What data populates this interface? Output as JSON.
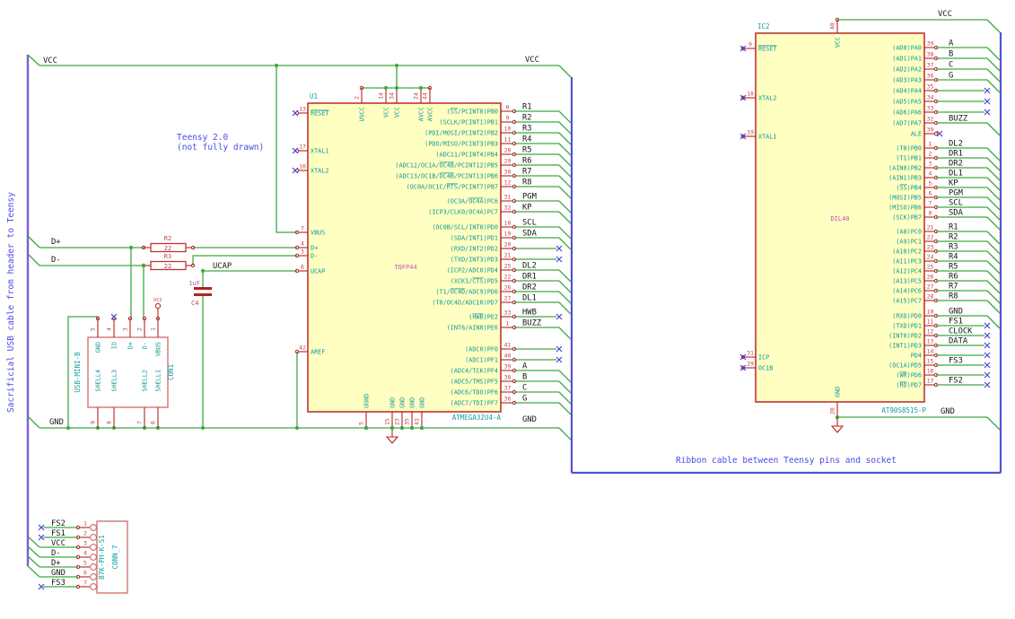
{
  "notes": {
    "teensy_line1": "Teensy 2.0",
    "teensy_line2": "(not fully drawn)",
    "sacrificial": "Sacrificial USB cable from header to Teensy",
    "ribbon": "Ribbon cable between Teensy pins and socket"
  },
  "colors": {
    "wire": "#3fa93f",
    "bus_left": "#7a5fd6",
    "bus_ribbon": "#5252cf",
    "ic_fill": "#ffffc2",
    "ic_border": "#c03434",
    "pin": "#b52222",
    "pin_number": "#c04545",
    "pin_name": "#0f9898",
    "reference": "#12a0a0",
    "value": "#c14fc1",
    "net_label": "#161616",
    "note": "#4a4ae8",
    "no_connect": "#4646d8",
    "connector_border": "#d06a6a",
    "junction": "#3fa93f"
  },
  "u1": {
    "ref": "U1",
    "value": "ATMEGA32U4-A",
    "package": "TQFP44",
    "top_pins": [
      {
        "num": "2",
        "name": "UVCC"
      },
      {
        "num": "14",
        "name": "VCC"
      },
      {
        "num": "34",
        "name": "VCC"
      },
      {
        "num": "24",
        "name": "AVCC"
      },
      {
        "num": "44",
        "name": "AVCC"
      }
    ],
    "bottom_pins": [
      {
        "num": "5",
        "name": "UGND"
      },
      {
        "num": "15",
        "name": "GND"
      },
      {
        "num": "23",
        "name": "GND"
      },
      {
        "num": "35",
        "name": "GND"
      },
      {
        "num": "43",
        "name": "GND"
      }
    ],
    "left_pins": [
      {
        "num": "13",
        "name": "~RESET~",
        "nc": true
      },
      {
        "num": "17",
        "name": "XTAL1",
        "nc": true
      },
      {
        "num": "16",
        "name": "XTAL2",
        "nc": true
      },
      {
        "num": "7",
        "name": "VBUS"
      },
      {
        "num": "4",
        "name": "D+"
      },
      {
        "num": "3",
        "name": "D-"
      },
      {
        "num": "6",
        "name": "UCAP"
      },
      {
        "num": "42",
        "name": "AREF"
      }
    ],
    "right_groups": [
      [
        {
          "num": "8",
          "name": "(~SS~/PCINT0)PB0",
          "net": "R1"
        },
        {
          "num": "9",
          "name": "(SCLK/PCINT1)PB1",
          "net": "R2"
        },
        {
          "num": "10",
          "name": "(PDI/MOSI/PCINT2)PB2",
          "net": "R3"
        },
        {
          "num": "11",
          "name": "(PDO/MISO/PCINT3)PB3",
          "net": "R4"
        },
        {
          "num": "28",
          "name": "(ADC11/PCINT4)PB4",
          "net": "R5"
        },
        {
          "num": "29",
          "name": "(ADC12/OC1A/~OC4B~/PCINT12)PB5",
          "net": "R6"
        },
        {
          "num": "30",
          "name": "(ADC13/OC1B/~OC4B~/PCINT13)PB6",
          "net": "R7"
        },
        {
          "num": "12",
          "name": "(OC0A/OC1C/~RTS~/PCINT7)PB7",
          "net": "R8"
        }
      ],
      [
        {
          "num": "31",
          "name": "(OC3A/~OC4A~)PC6",
          "net": "PGM"
        },
        {
          "num": "32",
          "name": "(ICP3/CLK0/OC4A)PC7",
          "net": "KP"
        }
      ],
      [
        {
          "num": "18",
          "name": "(OC0B/SCL/INT0)PD0",
          "net": "SCL"
        },
        {
          "num": "19",
          "name": "(SDA/INT1)PD1",
          "net": "SDA"
        },
        {
          "num": "20",
          "name": "(RXD/INT2)PD2",
          "nc": true
        },
        {
          "num": "21",
          "name": "(TXD/INT3)PD3",
          "nc": true
        },
        {
          "num": "25",
          "name": "(ICP2/ADC8)PD4",
          "net": "DL2"
        },
        {
          "num": "22",
          "name": "(XCK1/~CTS~)PD5",
          "net": "DR1"
        },
        {
          "num": "26",
          "name": "(T1/~OC4D~/ADC9)PD6",
          "net": "DR2"
        },
        {
          "num": "27",
          "name": "(T0/OC4D/ADC10)PD7",
          "net": "DL1"
        }
      ],
      [
        {
          "num": "33",
          "name": "(~HWB~)PE2",
          "net": "HWB",
          "nc": true
        },
        {
          "num": "1",
          "name": "(INT6/AIN0)PE6",
          "net": "BUZZ"
        }
      ],
      [
        {
          "num": "41",
          "name": "(ADC0)PF0",
          "nc": true
        },
        {
          "num": "40",
          "name": "(ADC1)PF1",
          "nc": true
        },
        {
          "num": "39",
          "name": "(ADC4/TCK)PF4",
          "net": "A"
        },
        {
          "num": "38",
          "name": "(ADC5/TMS)PF5",
          "net": "B"
        },
        {
          "num": "37",
          "name": "(ADC6/TDO)PF6",
          "net": "C"
        },
        {
          "num": "36",
          "name": "(ADC7/TDI)PF7",
          "net": "G"
        }
      ]
    ]
  },
  "ic2": {
    "ref": "IC2",
    "value": "AT90S8515-P",
    "package": "DIL40",
    "top_pin": {
      "num": "40",
      "name": "VCC"
    },
    "bottom_pin": {
      "num": "20",
      "name": "GND"
    },
    "left_pins": [
      {
        "num": "9",
        "name": "~RESET~",
        "nc": true
      },
      {
        "num": "18",
        "name": "XTAL2",
        "nc": true
      },
      {
        "num": "19",
        "name": "XTAL1",
        "nc": true
      },
      {
        "num": "31",
        "name": "ICP",
        "nc": true
      },
      {
        "num": "29",
        "name": "OC1B",
        "nc": true
      }
    ],
    "right_groups": [
      [
        {
          "num": "39",
          "name": "(AD0)PA0",
          "net": "A"
        },
        {
          "num": "38",
          "name": "(AD1)PA1",
          "net": "B"
        },
        {
          "num": "37",
          "name": "(AD2)PA2",
          "net": "C"
        },
        {
          "num": "36",
          "name": "(AD3)PA3",
          "net": "G"
        },
        {
          "num": "35",
          "name": "(AD4)PA4",
          "nc": true
        },
        {
          "num": "34",
          "name": "(AD5)PA5",
          "nc": true
        },
        {
          "num": "33",
          "name": "(AD6)PA6",
          "nc": true
        },
        {
          "num": "32",
          "name": "(AD7)PA7",
          "net": "BUZZ"
        }
      ],
      [
        {
          "num": "30",
          "name": "ALE",
          "conn": "ncstub"
        }
      ],
      [
        {
          "num": "1",
          "name": "(T0)PB0",
          "net": "DL2"
        },
        {
          "num": "2",
          "name": "(T1)PB1",
          "net": "DR1"
        },
        {
          "num": "3",
          "name": "(AIN0)PB2",
          "net": "DR2"
        },
        {
          "num": "4",
          "name": "(AIN1)PB3",
          "net": "DL1"
        },
        {
          "num": "5",
          "name": "(~SS~)PB4",
          "net": "KP"
        },
        {
          "num": "6",
          "name": "(MOSI)PB5",
          "net": "PGM"
        },
        {
          "num": "7",
          "name": "(MISO)PB6",
          "net": "SCL"
        },
        {
          "num": "8",
          "name": "(SCK)PB7",
          "net": "SDA"
        }
      ],
      [
        {
          "num": "21",
          "name": "(A8)PC0",
          "net": "R1"
        },
        {
          "num": "22",
          "name": "(A9)PC1",
          "net": "R2"
        },
        {
          "num": "23",
          "name": "(A10)PC2",
          "net": "R3"
        },
        {
          "num": "24",
          "name": "(A11)PC3",
          "net": "R4"
        },
        {
          "num": "25",
          "name": "(A12)PC4",
          "net": "R5"
        },
        {
          "num": "26",
          "name": "(A13)PC5",
          "net": "R6"
        },
        {
          "num": "27",
          "name": "(A14)PC6",
          "net": "R7"
        },
        {
          "num": "28",
          "name": "(A15)PC7",
          "net": "R8"
        }
      ],
      [
        {
          "num": "10",
          "name": "(RXD)PD0",
          "net": "GND"
        },
        {
          "num": "11",
          "name": "(TXD)PD1",
          "net": "FS1",
          "nc": true
        },
        {
          "num": "12",
          "name": "(INT0)PD2",
          "net": "CLOCK",
          "nc": true
        },
        {
          "num": "13",
          "name": "(INT1)PD3",
          "net": "DATA",
          "nc": true
        },
        {
          "num": "14",
          "name": "PD4",
          "nc": true
        },
        {
          "num": "15",
          "name": "(OC1A)PD5",
          "net": "FS3",
          "nc": true
        },
        {
          "num": "16",
          "name": "(~WR~)PD6",
          "nc": true
        },
        {
          "num": "17",
          "name": "(~RD~)PD7",
          "net": "FS2",
          "nc": true
        }
      ]
    ]
  },
  "con1": {
    "ref": "CON1",
    "part": "USB-MINI-B",
    "top_pins": [
      {
        "num": "5",
        "name": "GND"
      },
      {
        "num": "4",
        "name": "ID",
        "nc": true
      },
      {
        "num": "3",
        "name": "D+"
      },
      {
        "num": "2",
        "name": "D-"
      },
      {
        "num": "1",
        "name": "VBUS"
      }
    ],
    "bottom_pins": [
      {
        "num": "9",
        "name": "SHELL4"
      },
      {
        "num": "8",
        "name": "SHELL3"
      },
      {
        "num": "7",
        "name": "SHELL2"
      },
      {
        "num": "6",
        "name": "SHELL1"
      }
    ],
    "vcc_symbol": "VCC"
  },
  "conn7": {
    "ref": "CONN_7",
    "part": "B7K-PH-K-S1",
    "pins": [
      {
        "num": "1",
        "net": "FS2",
        "nc": true
      },
      {
        "num": "2",
        "net": "FS1",
        "nc": true
      },
      {
        "num": "3",
        "net": "VCC"
      },
      {
        "num": "4",
        "net": "D-"
      },
      {
        "num": "5",
        "net": "D+"
      },
      {
        "num": "6",
        "net": "GND"
      },
      {
        "num": "7",
        "net": "FS3",
        "nc": true
      }
    ]
  },
  "r2": {
    "ref": "R2",
    "value": "22"
  },
  "r3": {
    "ref": "R3",
    "value": "22"
  },
  "c4": {
    "ref": "C4",
    "value": "1uF"
  },
  "power_labels": [
    {
      "text": "VCC"
    },
    {
      "text": "VCC"
    },
    {
      "text": "GND"
    },
    {
      "text": "GND"
    },
    {
      "text": "D+"
    },
    {
      "text": "D-"
    },
    {
      "text": "UCAP"
    },
    {
      "text": "VCC"
    },
    {
      "text": "GND"
    }
  ]
}
